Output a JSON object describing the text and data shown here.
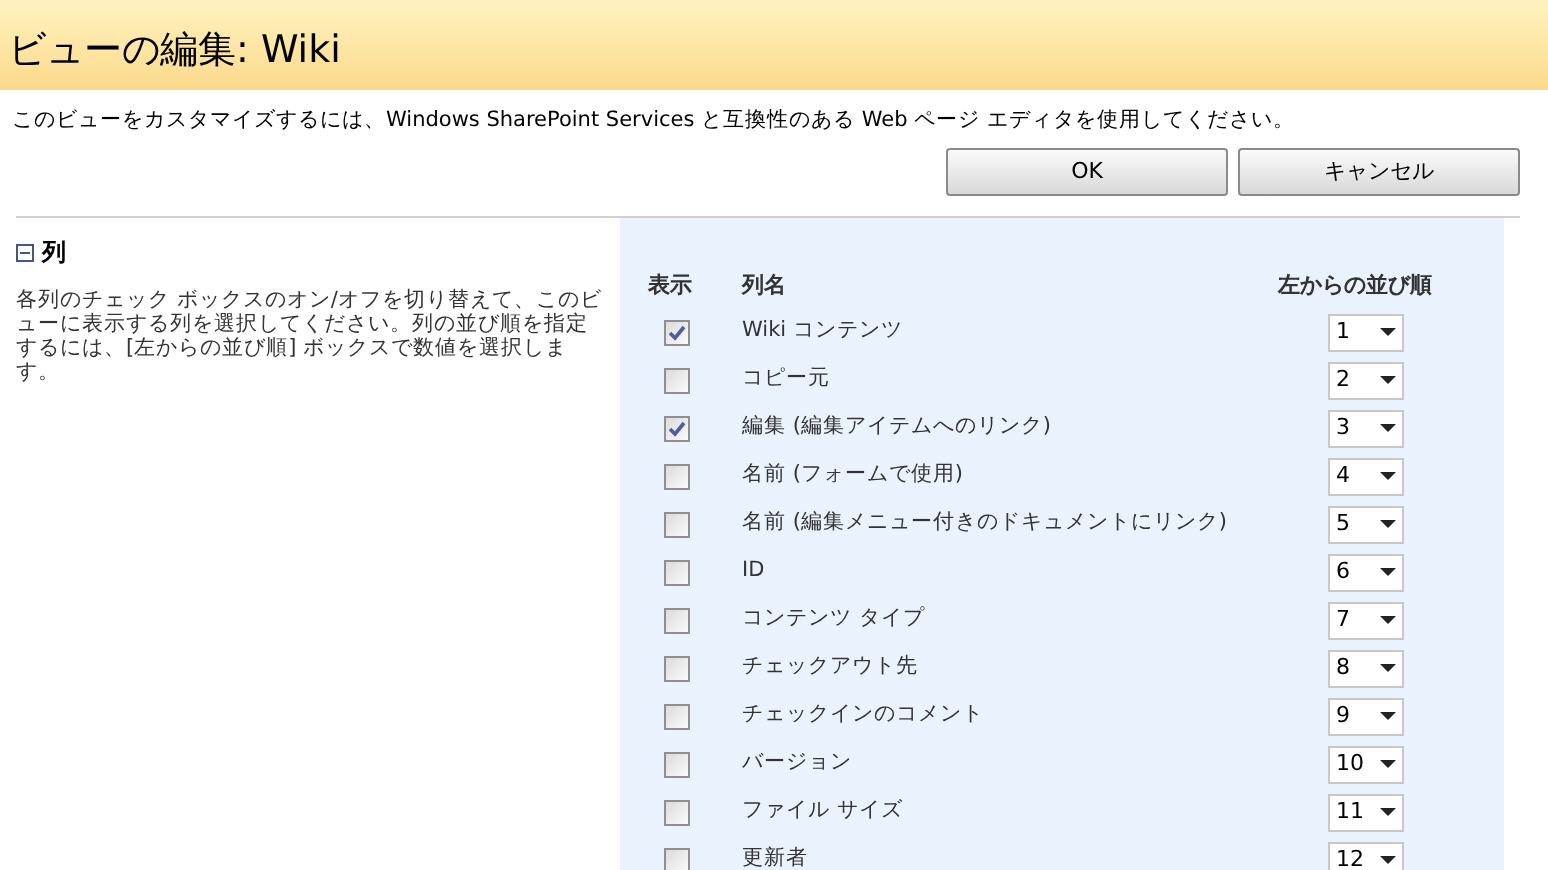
{
  "title": "ビューの編集: Wiki",
  "notice": "このビューをカスタマイズするには、Windows SharePoint Services と互換性のある Web ページ エディタを使用してください。",
  "buttons": [
    "OK",
    "キャンセル"
  ],
  "section": {
    "title": "列",
    "expanded": true,
    "description": "各列のチェック ボックスのオン/オフを切り替えて、このビューに表示する列を選択してください。列の並び順を指定するには、[左からの並び順] ボックスで数値を選択します。"
  },
  "table": {
    "columns": [
      "表示",
      "列名",
      "左からの並び順"
    ],
    "rows": [
      {
        "name": "Wiki コンテンツ",
        "checked": true,
        "order": "1"
      },
      {
        "name": "コピー元",
        "checked": false,
        "order": "2"
      },
      {
        "name": "編集 (編集アイテムへのリンク)",
        "checked": true,
        "order": "3"
      },
      {
        "name": "名前 (フォームで使用)",
        "checked": false,
        "order": "4"
      },
      {
        "name": "名前 (編集メニュー付きのドキュメントにリンク)",
        "checked": false,
        "order": "5"
      },
      {
        "name": "ID",
        "checked": false,
        "order": "6"
      },
      {
        "name": "コンテンツ タイプ",
        "checked": false,
        "order": "7"
      },
      {
        "name": "チェックアウト先",
        "checked": false,
        "order": "8"
      },
      {
        "name": "チェックインのコメント",
        "checked": false,
        "order": "9"
      },
      {
        "name": "バージョン",
        "checked": false,
        "order": "10"
      },
      {
        "name": "ファイル サイズ",
        "checked": false,
        "order": "11"
      },
      {
        "name": "更新者",
        "checked": false,
        "order": "12"
      }
    ]
  }
}
